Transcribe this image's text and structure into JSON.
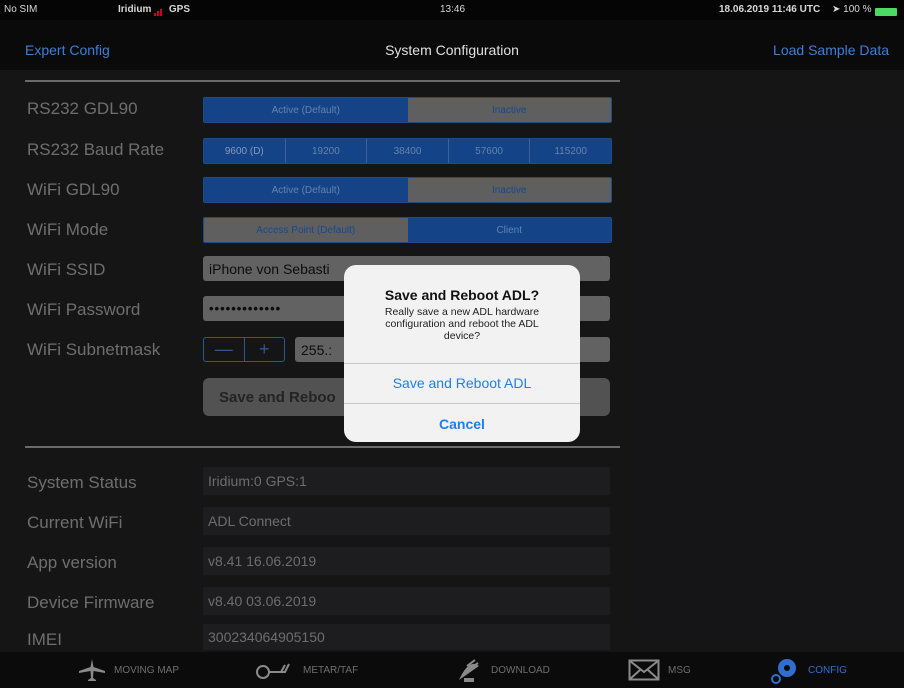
{
  "status_bar": {
    "carrier": "No SIM",
    "network": "Iridium",
    "gps": "GPS",
    "time": "13:46",
    "datetime": "18.06.2019 11:46 UTC",
    "battery": "100 %"
  },
  "nav": {
    "left": "Expert Config",
    "title": "System Configuration",
    "right": "Load Sample Data"
  },
  "config": {
    "rs232_gdl90": {
      "label": "RS232 GDL90",
      "options": [
        "Active (Default)",
        "Inactive"
      ],
      "selected": "Active (Default)"
    },
    "baud_rate": {
      "label": "RS232 Baud Rate",
      "options": [
        "9600 (D)",
        "19200",
        "38400",
        "57600",
        "115200"
      ]
    },
    "wifi_gdl90": {
      "label": "WiFi GDL90",
      "options": [
        "Active (Default)",
        "Inactive"
      ],
      "selected": "Active (Default)"
    },
    "wifi_mode": {
      "label": "WiFi Mode",
      "options": [
        "Access Point (Default)",
        "Client"
      ],
      "selected": "Client"
    },
    "wifi_ssid": {
      "label": "WiFi SSID",
      "value": "iPhone von Sebasti"
    },
    "wifi_password": {
      "label": "WiFi Password",
      "value": "•••••••••••••"
    },
    "wifi_subnetmask": {
      "label": "WiFi Subnetmask",
      "minus": "—",
      "plus": "+",
      "value": "255.:"
    },
    "save_button": "Save and Reboo"
  },
  "status": [
    {
      "label": "System Status",
      "value": "Iridium:0 GPS:1"
    },
    {
      "label": "Current WiFi",
      "value": "ADL Connect"
    },
    {
      "label": "App version",
      "value": "v8.41 16.06.2019"
    },
    {
      "label": "Device Firmware",
      "value": "v8.40 03.06.2019"
    },
    {
      "label": "IMEI",
      "value": "300234064905150"
    }
  ],
  "alert": {
    "title": "Save and Reboot ADL?",
    "message": "Really save a new ADL hardware configuration and reboot the ADL device?",
    "confirm": "Save and Reboot ADL",
    "cancel": "Cancel"
  },
  "tabs": [
    {
      "label": "MOVING MAP",
      "icon": "airplane-icon"
    },
    {
      "label": "METAR/TAF",
      "icon": "windsock-icon"
    },
    {
      "label": "DOWNLOAD",
      "icon": "satellite-icon"
    },
    {
      "label": "MSG",
      "icon": "envelope-icon"
    },
    {
      "label": "CONFIG",
      "icon": "gear-icon",
      "active": true
    }
  ],
  "colors": {
    "accent": "#1f7ef0",
    "segment_active": "#1a57ad",
    "background": "#1b1b1d"
  }
}
